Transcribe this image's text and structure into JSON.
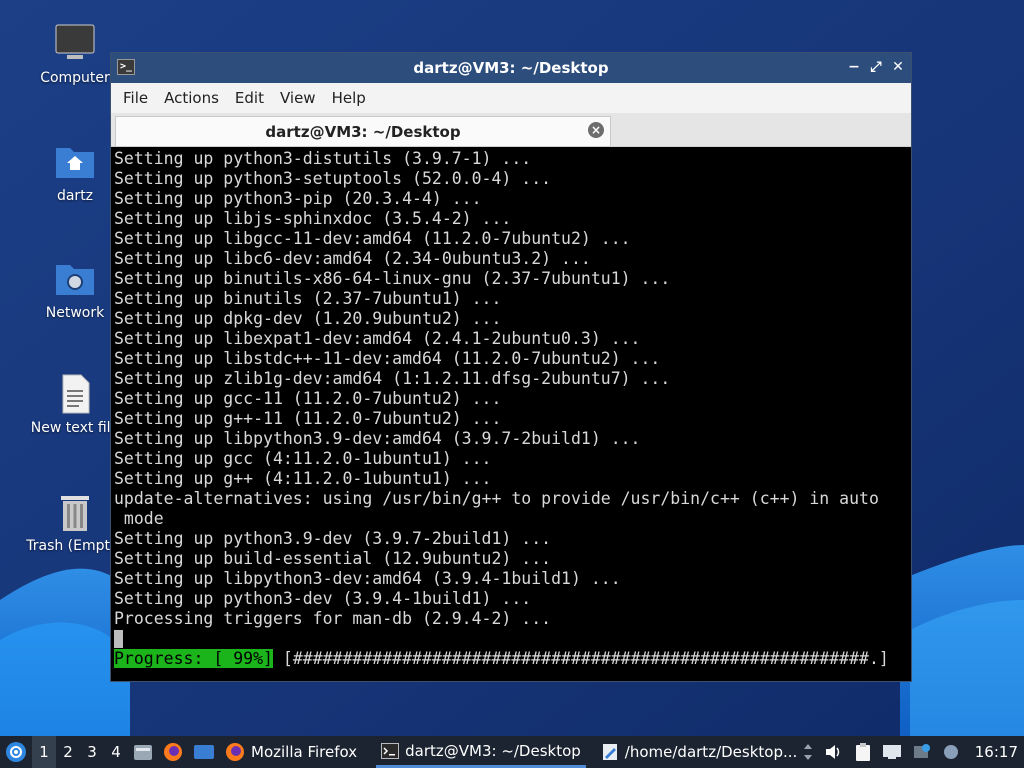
{
  "desktop": {
    "icons": [
      {
        "label": "Computer",
        "icon": "computer-icon"
      },
      {
        "label": "dartz",
        "icon": "home-folder-icon"
      },
      {
        "label": "Network",
        "icon": "network-folder-icon"
      },
      {
        "label": "New text file",
        "icon": "text-file-icon"
      },
      {
        "label": "Trash (Empty)",
        "icon": "trash-icon"
      }
    ]
  },
  "window": {
    "title": "dartz@VM3: ~/Desktop",
    "menu": [
      "File",
      "Actions",
      "Edit",
      "View",
      "Help"
    ],
    "tab_title": "dartz@VM3: ~/Desktop"
  },
  "terminal": {
    "lines": [
      "Setting up python3-distutils (3.9.7-1) ...",
      "Setting up python3-setuptools (52.0.0-4) ...",
      "Setting up python3-pip (20.3.4-4) ...",
      "Setting up libjs-sphinxdoc (3.5.4-2) ...",
      "Setting up libgcc-11-dev:amd64 (11.2.0-7ubuntu2) ...",
      "Setting up libc6-dev:amd64 (2.34-0ubuntu3.2) ...",
      "Setting up binutils-x86-64-linux-gnu (2.37-7ubuntu1) ...",
      "Setting up binutils (2.37-7ubuntu1) ...",
      "Setting up dpkg-dev (1.20.9ubuntu2) ...",
      "Setting up libexpat1-dev:amd64 (2.4.1-2ubuntu0.3) ...",
      "Setting up libstdc++-11-dev:amd64 (11.2.0-7ubuntu2) ...",
      "Setting up zlib1g-dev:amd64 (1:1.2.11.dfsg-2ubuntu7) ...",
      "Setting up gcc-11 (11.2.0-7ubuntu2) ...",
      "Setting up g++-11 (11.2.0-7ubuntu2) ...",
      "Setting up libpython3.9-dev:amd64 (3.9.7-2build1) ...",
      "Setting up gcc (4:11.2.0-1ubuntu1) ...",
      "Setting up g++ (4:11.2.0-1ubuntu1) ...",
      "update-alternatives: using /usr/bin/g++ to provide /usr/bin/c++ (c++) in auto",
      " mode",
      "Setting up python3.9-dev (3.9.7-2build1) ...",
      "Setting up build-essential (12.9ubuntu2) ...",
      "Setting up libpython3-dev:amd64 (3.9.4-1build1) ...",
      "Setting up python3-dev (3.9.4-1build1) ...",
      "Processing triggers for man-db (2.9.4-2) ..."
    ],
    "progress_label": "Progress: [ 99%]",
    "progress_bar": " [##########################################################.]",
    "progress_percent": 99
  },
  "taskbar": {
    "workspaces": [
      "1",
      "2",
      "3",
      "4"
    ],
    "active_workspace": "1",
    "tasks": [
      {
        "label": "Mozilla Firefox",
        "icon": "firefox-icon"
      },
      {
        "label": "dartz@VM3: ~/Desktop",
        "icon": "terminal-icon"
      },
      {
        "label": "/home/dartz/Desktop...",
        "icon": "text-editor-icon"
      }
    ],
    "clock": "16:17"
  },
  "colors": {
    "titlebar": "#2d4d7d",
    "progress": "#1bb51b",
    "taskbar": "#1b2430"
  }
}
